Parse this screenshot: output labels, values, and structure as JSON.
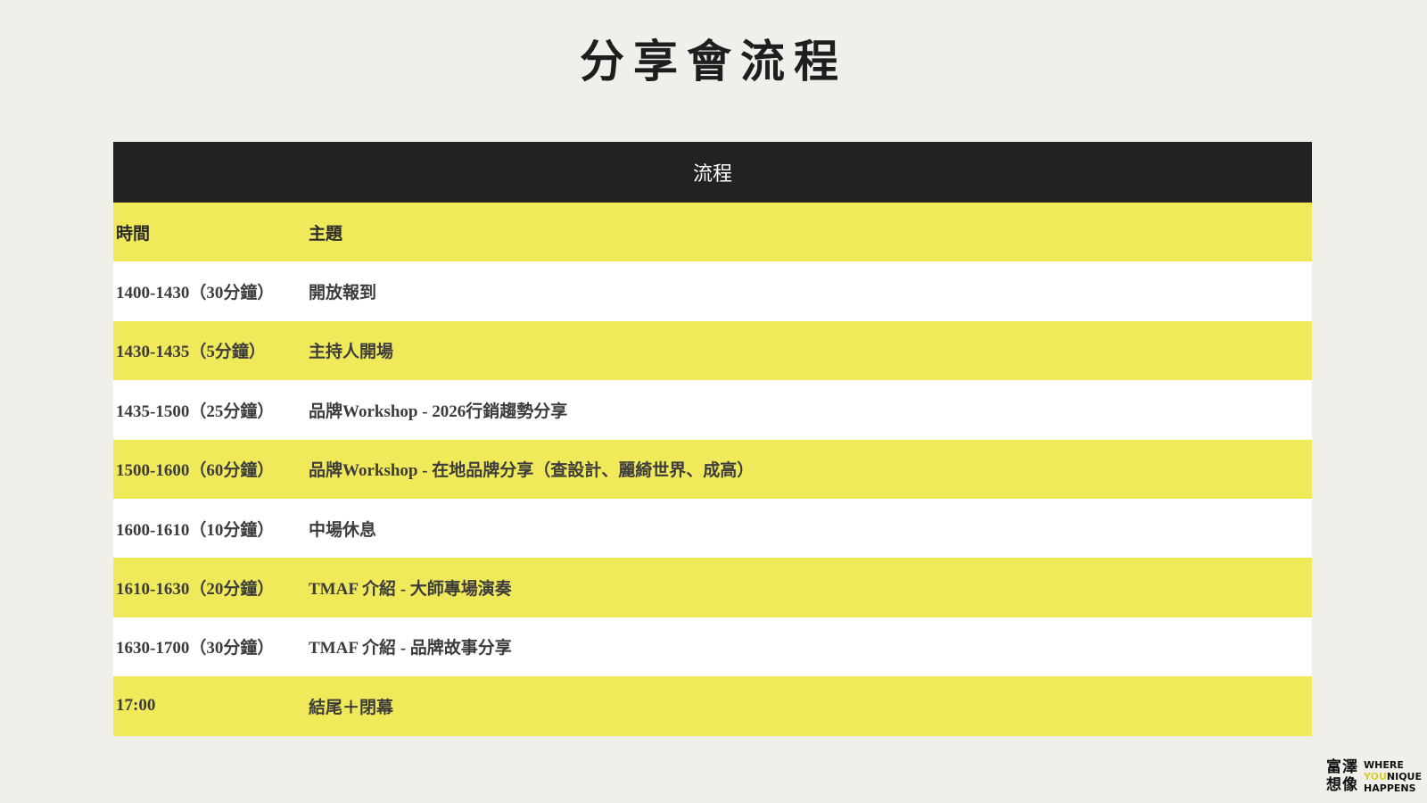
{
  "page": {
    "title": "分享會流程"
  },
  "table": {
    "header": "流程",
    "columns": {
      "time": "時間",
      "topic": "主題"
    },
    "rows": [
      {
        "time": "1400-1430（30分鐘）",
        "topic": "開放報到"
      },
      {
        "time": "1430-1435（5分鐘）",
        "topic": "主持人開場"
      },
      {
        "time": "1435-1500（25分鐘）",
        "topic": "品牌Workshop - 2026行銷趨勢分享"
      },
      {
        "time": "1500-1600（60分鐘）",
        "topic": "品牌Workshop - 在地品牌分享（查設計、麗綺世界、成高）"
      },
      {
        "time": "1600-1610（10分鐘）",
        "topic": "中場休息"
      },
      {
        "time": "1610-1630（20分鐘）",
        "topic": "TMAF 介紹 - 大師專場演奏"
      },
      {
        "time": "1630-1700（30分鐘）",
        "topic": "TMAF 介紹 - 品牌故事分享"
      },
      {
        "time": "17:00",
        "topic": "結尾＋閉幕"
      }
    ]
  },
  "logo": {
    "cn_line1": "富澤",
    "cn_line2": "想像",
    "en_line1": "WHERE",
    "en_line2_accent": "YOU",
    "en_line2_rest": "NIQUE",
    "en_line3": "HAPPENS"
  },
  "colors": {
    "background": "#f0efea",
    "header": "#222222",
    "row_highlight": "#f0e95a",
    "row_plain": "#ffffff"
  }
}
